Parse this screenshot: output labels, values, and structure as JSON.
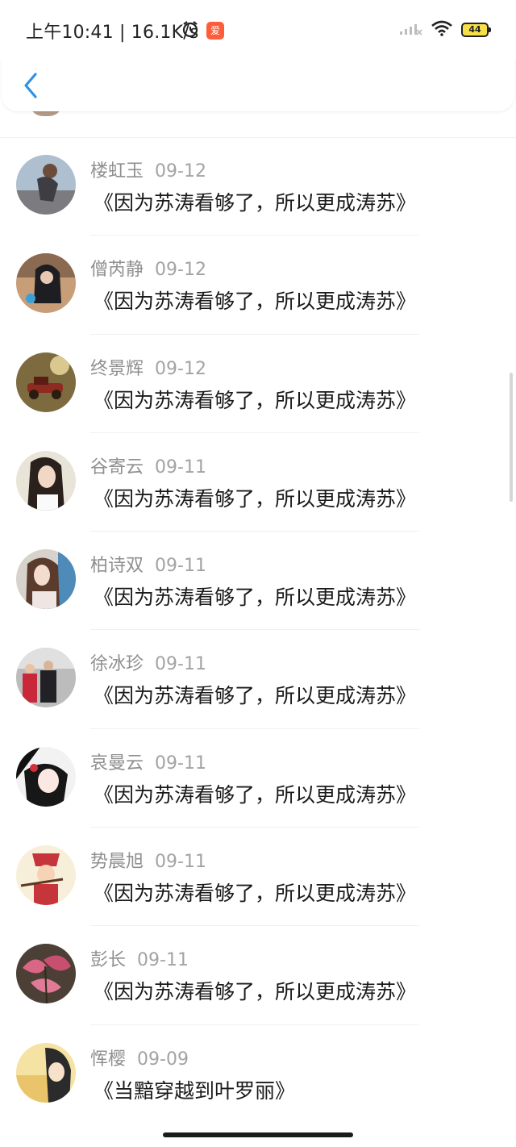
{
  "status_bar": {
    "time_speed": "上午10:41 | 16.1K/s",
    "app_badge": "爱",
    "battery": "44"
  },
  "comments": [
    {
      "name": "楼虹玉",
      "date": "09-12",
      "text": "《因为苏涛看够了，所以更成涛苏》"
    },
    {
      "name": "僧芮静",
      "date": "09-12",
      "text": "《因为苏涛看够了，所以更成涛苏》"
    },
    {
      "name": "终景辉",
      "date": "09-12",
      "text": "《因为苏涛看够了，所以更成涛苏》"
    },
    {
      "name": "谷寄云",
      "date": "09-11",
      "text": "《因为苏涛看够了，所以更成涛苏》"
    },
    {
      "name": "柏诗双",
      "date": "09-11",
      "text": "《因为苏涛看够了，所以更成涛苏》"
    },
    {
      "name": "徐冰珍",
      "date": "09-11",
      "text": "《因为苏涛看够了，所以更成涛苏》"
    },
    {
      "name": "哀曼云",
      "date": "09-11",
      "text": "《因为苏涛看够了，所以更成涛苏》"
    },
    {
      "name": "势晨旭",
      "date": "09-11",
      "text": "《因为苏涛看够了，所以更成涛苏》"
    },
    {
      "name": "彭长",
      "date": "09-11",
      "text": "《因为苏涛看够了，所以更成涛苏》"
    },
    {
      "name": "恽樱",
      "date": "09-09",
      "text": "《当黯穿越到叶罗丽》"
    }
  ]
}
